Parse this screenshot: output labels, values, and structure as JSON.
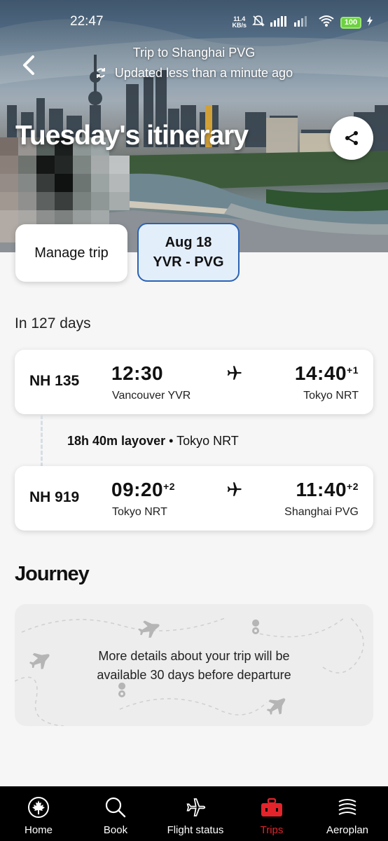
{
  "status_bar": {
    "time": "22:47",
    "net_speed_value": "11.4",
    "net_speed_unit": "KB/s",
    "battery": "100"
  },
  "header": {
    "back_icon": "chevron-left-icon",
    "trip_title": "Trip to Shanghai PVG",
    "updated": "Updated less than a minute ago",
    "page_title": "Tuesday's itinerary",
    "share_icon": "share-icon"
  },
  "tabs": {
    "manage": "Manage trip",
    "flight_date": "Aug 18",
    "flight_route": "YVR - PVG"
  },
  "countdown": "In 127 days",
  "flights": [
    {
      "number": "NH 135",
      "dep_time": "12:30",
      "dep_offset": "",
      "dep_airport": "Vancouver YVR",
      "arr_time": "14:40",
      "arr_offset": "+1",
      "arr_airport": "Tokyo NRT"
    },
    {
      "number": "NH 919",
      "dep_time": "09:20",
      "dep_offset": "+2",
      "dep_airport": "Tokyo NRT",
      "arr_time": "11:40",
      "arr_offset": "+2",
      "arr_airport": "Shanghai PVG"
    }
  ],
  "layover": {
    "duration": "18h 40m layover",
    "separator": "•",
    "location": "Tokyo NRT"
  },
  "journey": {
    "title": "Journey",
    "line1": "More details about your trip will be",
    "line2": "available 30 days before departure"
  },
  "bottom_nav": [
    {
      "label": "Home",
      "icon": "maple-leaf-icon"
    },
    {
      "label": "Book",
      "icon": "search-icon"
    },
    {
      "label": "Flight status",
      "icon": "airplane-icon"
    },
    {
      "label": "Trips",
      "icon": "suitcase-icon",
      "active": true
    },
    {
      "label": "Aeroplan",
      "icon": "aeroplan-icon"
    }
  ],
  "colors": {
    "accent_red": "#e3242b",
    "tab_active_border": "#2a63b4",
    "tab_active_bg": "#e3eefb",
    "battery_green": "#6cd13f"
  }
}
